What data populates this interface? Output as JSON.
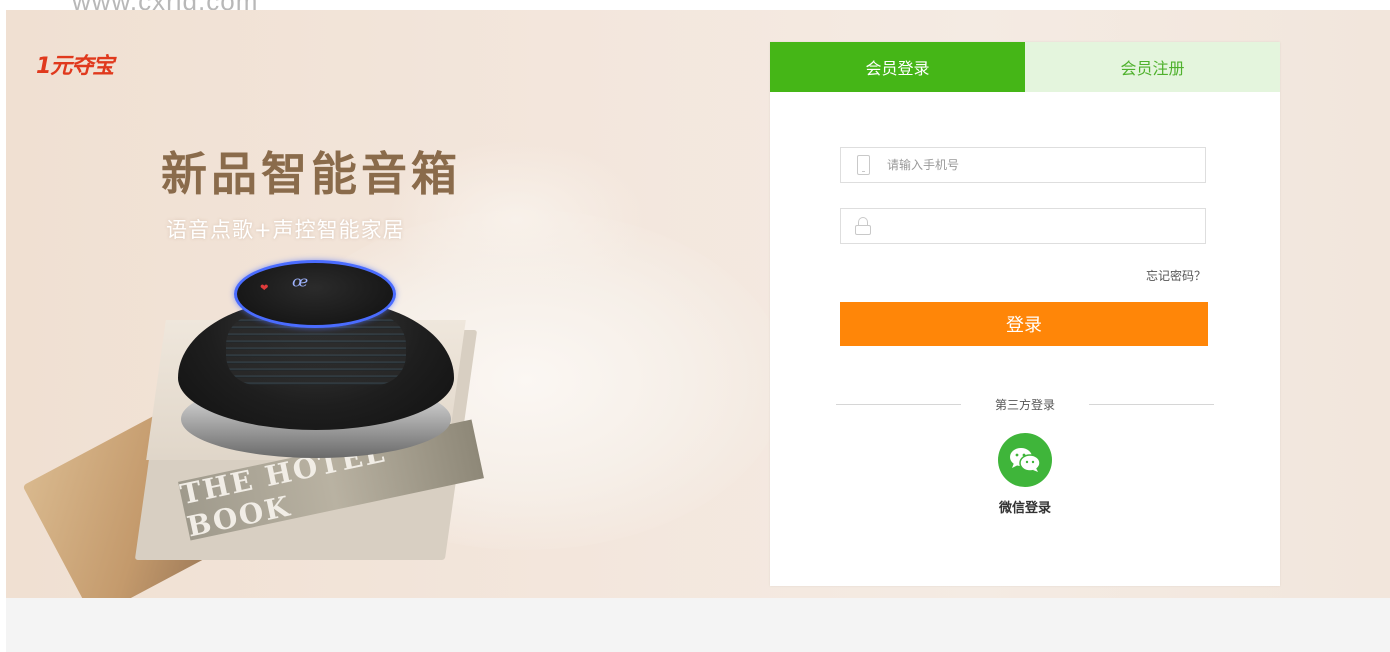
{
  "watermark": "www.cxrid.com",
  "brand": {
    "logo_text": "1元夺宝"
  },
  "promo": {
    "headline": "新品智能音箱",
    "subhead": "语音点歌+声控智能家居",
    "book_title": "THE HOTEL BOOK"
  },
  "login": {
    "tabs": [
      {
        "label": "会员登录",
        "active": true
      },
      {
        "label": "会员注册",
        "active": false
      }
    ],
    "phone_placeholder": "请输入手机号",
    "password_placeholder": "",
    "forgot_label": "忘记密码？",
    "submit_label": "登录",
    "third_party_label": "第三方登录",
    "wechat_label": "微信登录"
  },
  "colors": {
    "tab_active": "#45b617",
    "tab_inactive_bg": "#e4f5dd",
    "login_button": "#ff8608",
    "wechat": "#3fb53a",
    "logo": "#e0391d",
    "headline": "#8a6b4b"
  },
  "icons": {
    "phone": "phone-icon",
    "lock": "lock-icon",
    "wechat": "wechat-icon"
  }
}
